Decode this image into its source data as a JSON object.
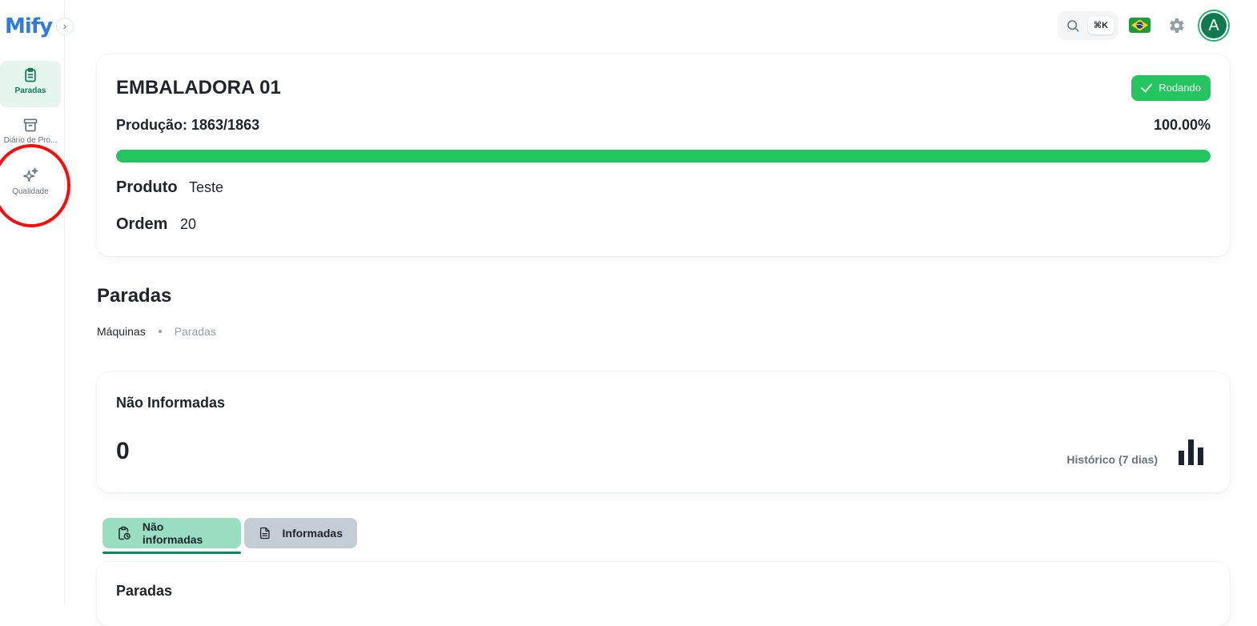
{
  "sidebar": {
    "logo": "Mify",
    "collapse_icon": "chevron-right-icon",
    "items": [
      {
        "label": "Paradas",
        "icon": "clipboard-icon",
        "active": true
      },
      {
        "label": "Diário de Pro...",
        "icon": "archive-icon",
        "active": false
      },
      {
        "label": "Qualidade",
        "icon": "sparkles-icon",
        "active": false
      }
    ]
  },
  "header": {
    "search_icon": "search-icon",
    "shortcut": "⌘K",
    "language_flag": "brazil-flag-icon",
    "settings_icon": "gear-icon",
    "avatar_letter": "A"
  },
  "machine": {
    "title": "EMBALADORA 01",
    "status": "Rodando",
    "status_color": "#22c55e",
    "production_label": "Produção: 1863/1863",
    "production_percent": "100.00%",
    "progress": 1.0,
    "product_label": "Produto",
    "product_value": "Teste",
    "order_label": "Ordem",
    "order_value": "20"
  },
  "section": {
    "title": "Paradas",
    "breadcrumb": [
      "Máquinas",
      "Paradas"
    ]
  },
  "stats": {
    "title": "Não Informadas",
    "value": "0",
    "history_label": "Histórico (7 dias)"
  },
  "tabs": [
    {
      "label": "Não informadas",
      "icon": "clipboard-clock-icon",
      "active": true
    },
    {
      "label": "Informadas",
      "icon": "document-icon",
      "active": false
    }
  ],
  "list": {
    "title": "Paradas"
  },
  "colors": {
    "accent": "#0c7e55",
    "success": "#22c55e",
    "highlight": "#ff0a0a"
  }
}
